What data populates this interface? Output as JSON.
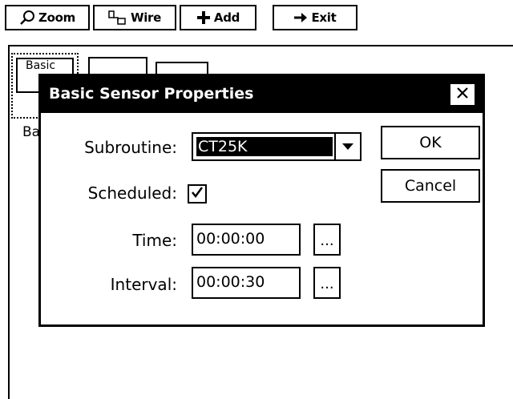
{
  "toolbar": {
    "zoom_label": "Zoom",
    "wire_label": "Wire",
    "add_label": "Add",
    "exit_label": "Exit"
  },
  "workspace": {
    "tool_basic_label": "Basic",
    "peek_label": "Ba"
  },
  "dialog": {
    "title": "Basic Sensor Properties",
    "subroutine_label": "Subroutine:",
    "subroutine_value": "CT25K",
    "scheduled_label": "Scheduled:",
    "scheduled_checked": true,
    "time_label": "Time:",
    "time_value": "00:00:00",
    "interval_label": "Interval:",
    "interval_value": "00:00:30",
    "ellipsis": "...",
    "ok_label": "OK",
    "cancel_label": "Cancel"
  },
  "icons": {
    "zoom": "magnifier-icon",
    "wire": "wire-icon",
    "add": "plus-icon",
    "exit": "arrow-right-icon",
    "close": "close-icon",
    "dropdown": "triangle-down-icon",
    "check": "check-icon"
  }
}
